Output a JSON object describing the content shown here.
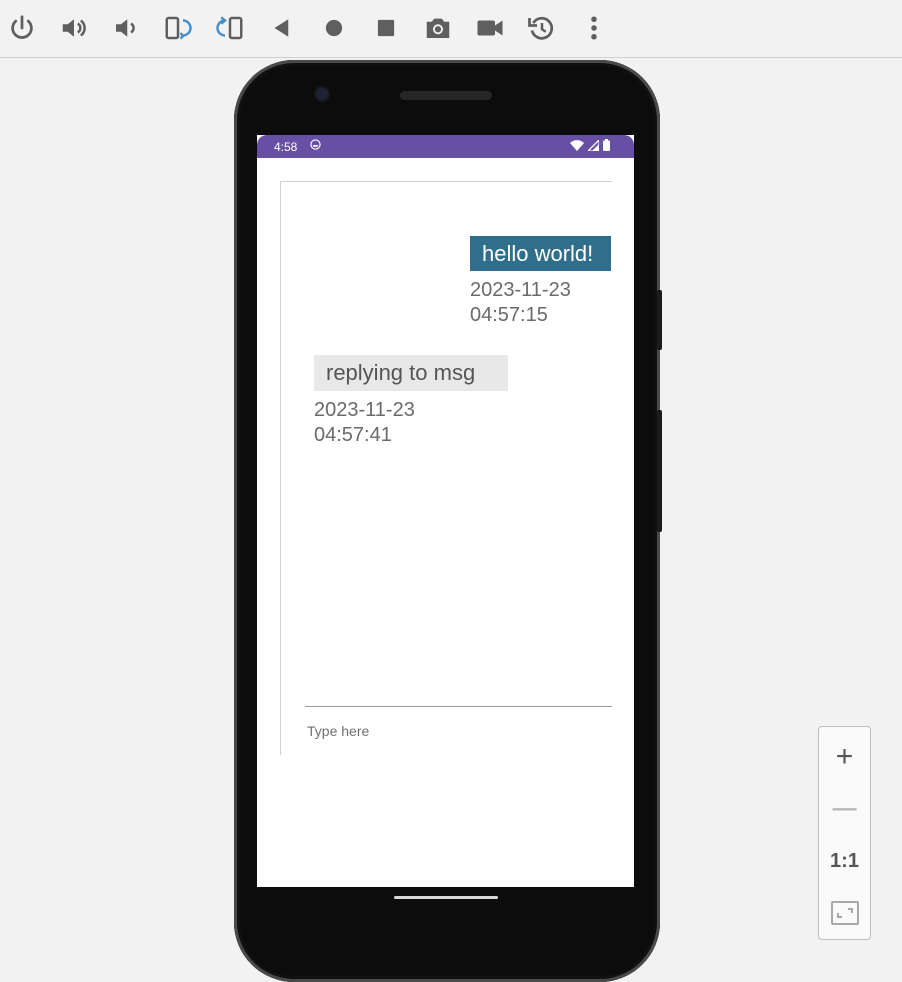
{
  "toolbar": {
    "buttons": [
      {
        "name": "power-icon"
      },
      {
        "name": "volume-up-icon"
      },
      {
        "name": "volume-down-icon"
      },
      {
        "name": "rotate-left-icon"
      },
      {
        "name": "rotate-right-icon"
      },
      {
        "name": "back-icon"
      },
      {
        "name": "home-icon"
      },
      {
        "name": "overview-icon"
      },
      {
        "name": "screenshot-icon"
      },
      {
        "name": "record-icon"
      },
      {
        "name": "snapshot-icon"
      },
      {
        "name": "more-icon"
      }
    ],
    "accent_color": "#4a90c8",
    "icon_color": "#5f5f5f"
  },
  "status_bar": {
    "time": "4:58",
    "color": "#6750a4"
  },
  "chat": {
    "messages": [
      {
        "direction": "sent",
        "text": "hello world!",
        "timestamp": "2023-11-23\n04:57:15",
        "bubble_color": "#2f6f8c"
      },
      {
        "direction": "received",
        "text": "replying to msg",
        "timestamp": "2023-11-23\n04:57:41",
        "bubble_color": "#e8e8e8"
      }
    ],
    "input": {
      "placeholder": "Type here",
      "value": ""
    }
  },
  "zoom_panel": {
    "zoom_in": "+",
    "zoom_out": "—",
    "one_to_one": "1:1",
    "fit_icon": "fit-screen-icon"
  }
}
